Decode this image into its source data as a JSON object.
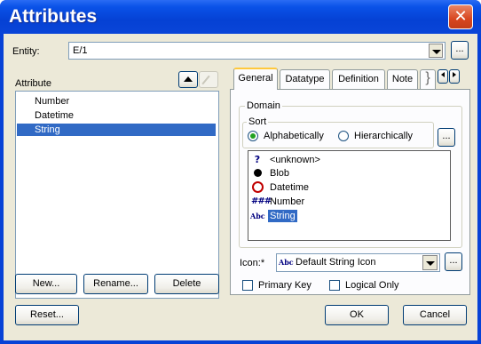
{
  "window": {
    "title": "Attributes",
    "close_symbol": "✕"
  },
  "entity": {
    "label": "Entity:",
    "value": "E/1",
    "browse_label": "..."
  },
  "attribute_list": {
    "label": "Attribute",
    "items": [
      "Number",
      "Datetime",
      "String"
    ],
    "selected": "String"
  },
  "order_buttons": {
    "up_icon": "arrow-up-icon",
    "edit_icon": "pencil-icon"
  },
  "list_buttons": {
    "new": "New...",
    "rename": "Rename...",
    "delete": "Delete"
  },
  "tabs": [
    "General",
    "Datatype",
    "Definition",
    "Note",
    "}"
  ],
  "active_tab": "General",
  "domain": {
    "group_label": "Domain",
    "sort": {
      "group_label": "Sort",
      "alphabetically": "Alphabetically",
      "hierarchically": "Hierarchically",
      "selected": "Alphabetically"
    },
    "browse_label": "...",
    "items": [
      {
        "label": "<unknown>",
        "icon": "question-icon"
      },
      {
        "label": "Blob",
        "icon": "black-dot-icon"
      },
      {
        "label": "Datetime",
        "icon": "clock-icon"
      },
      {
        "label": "Number",
        "icon": "number-hash-icon"
      },
      {
        "label": "String",
        "icon": "abc-string-icon"
      }
    ],
    "selected": "String"
  },
  "icon_field": {
    "label": "Icon:*",
    "value": "Default String Icon",
    "icon": "abc-string-icon",
    "browse_label": "..."
  },
  "checkboxes": {
    "primary_key": "Primary Key",
    "logical_only": "Logical Only"
  },
  "footer": {
    "reset": "Reset...",
    "ok": "OK",
    "cancel": "Cancel"
  },
  "colors": {
    "title_bar": "#0a52e8",
    "close_button": "#d8461f",
    "selection": "#316ac5",
    "window_bg": "#ece9d8"
  }
}
